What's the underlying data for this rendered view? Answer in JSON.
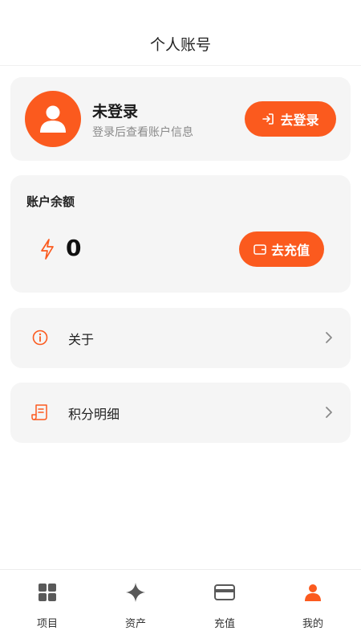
{
  "header": {
    "title": "个人账号"
  },
  "profile": {
    "avatar_icon": "user-avatar-icon",
    "name": "未登录",
    "subtitle": "登录后查看账户信息",
    "login_button": "去登录",
    "login_icon": "login-enter-icon"
  },
  "balance": {
    "title": "账户余额",
    "icon": "lightning-bolt-icon",
    "value": "0",
    "recharge_button": "去充值",
    "recharge_icon": "wallet-icon"
  },
  "menu": [
    {
      "label": "关于",
      "icon": "info-circle-icon"
    },
    {
      "label": "积分明细",
      "icon": "receipt-scroll-icon"
    }
  ],
  "tabbar": {
    "items": [
      {
        "label": "项目",
        "icon": "grid-icon"
      },
      {
        "label": "资产",
        "icon": "sparkle-icon"
      },
      {
        "label": "充值",
        "icon": "card-icon"
      },
      {
        "label": "我的",
        "icon": "person-icon"
      }
    ]
  },
  "colors": {
    "accent": "#fb5a1e",
    "card_bg": "#f5f5f5",
    "icon_dark": "#595959"
  }
}
